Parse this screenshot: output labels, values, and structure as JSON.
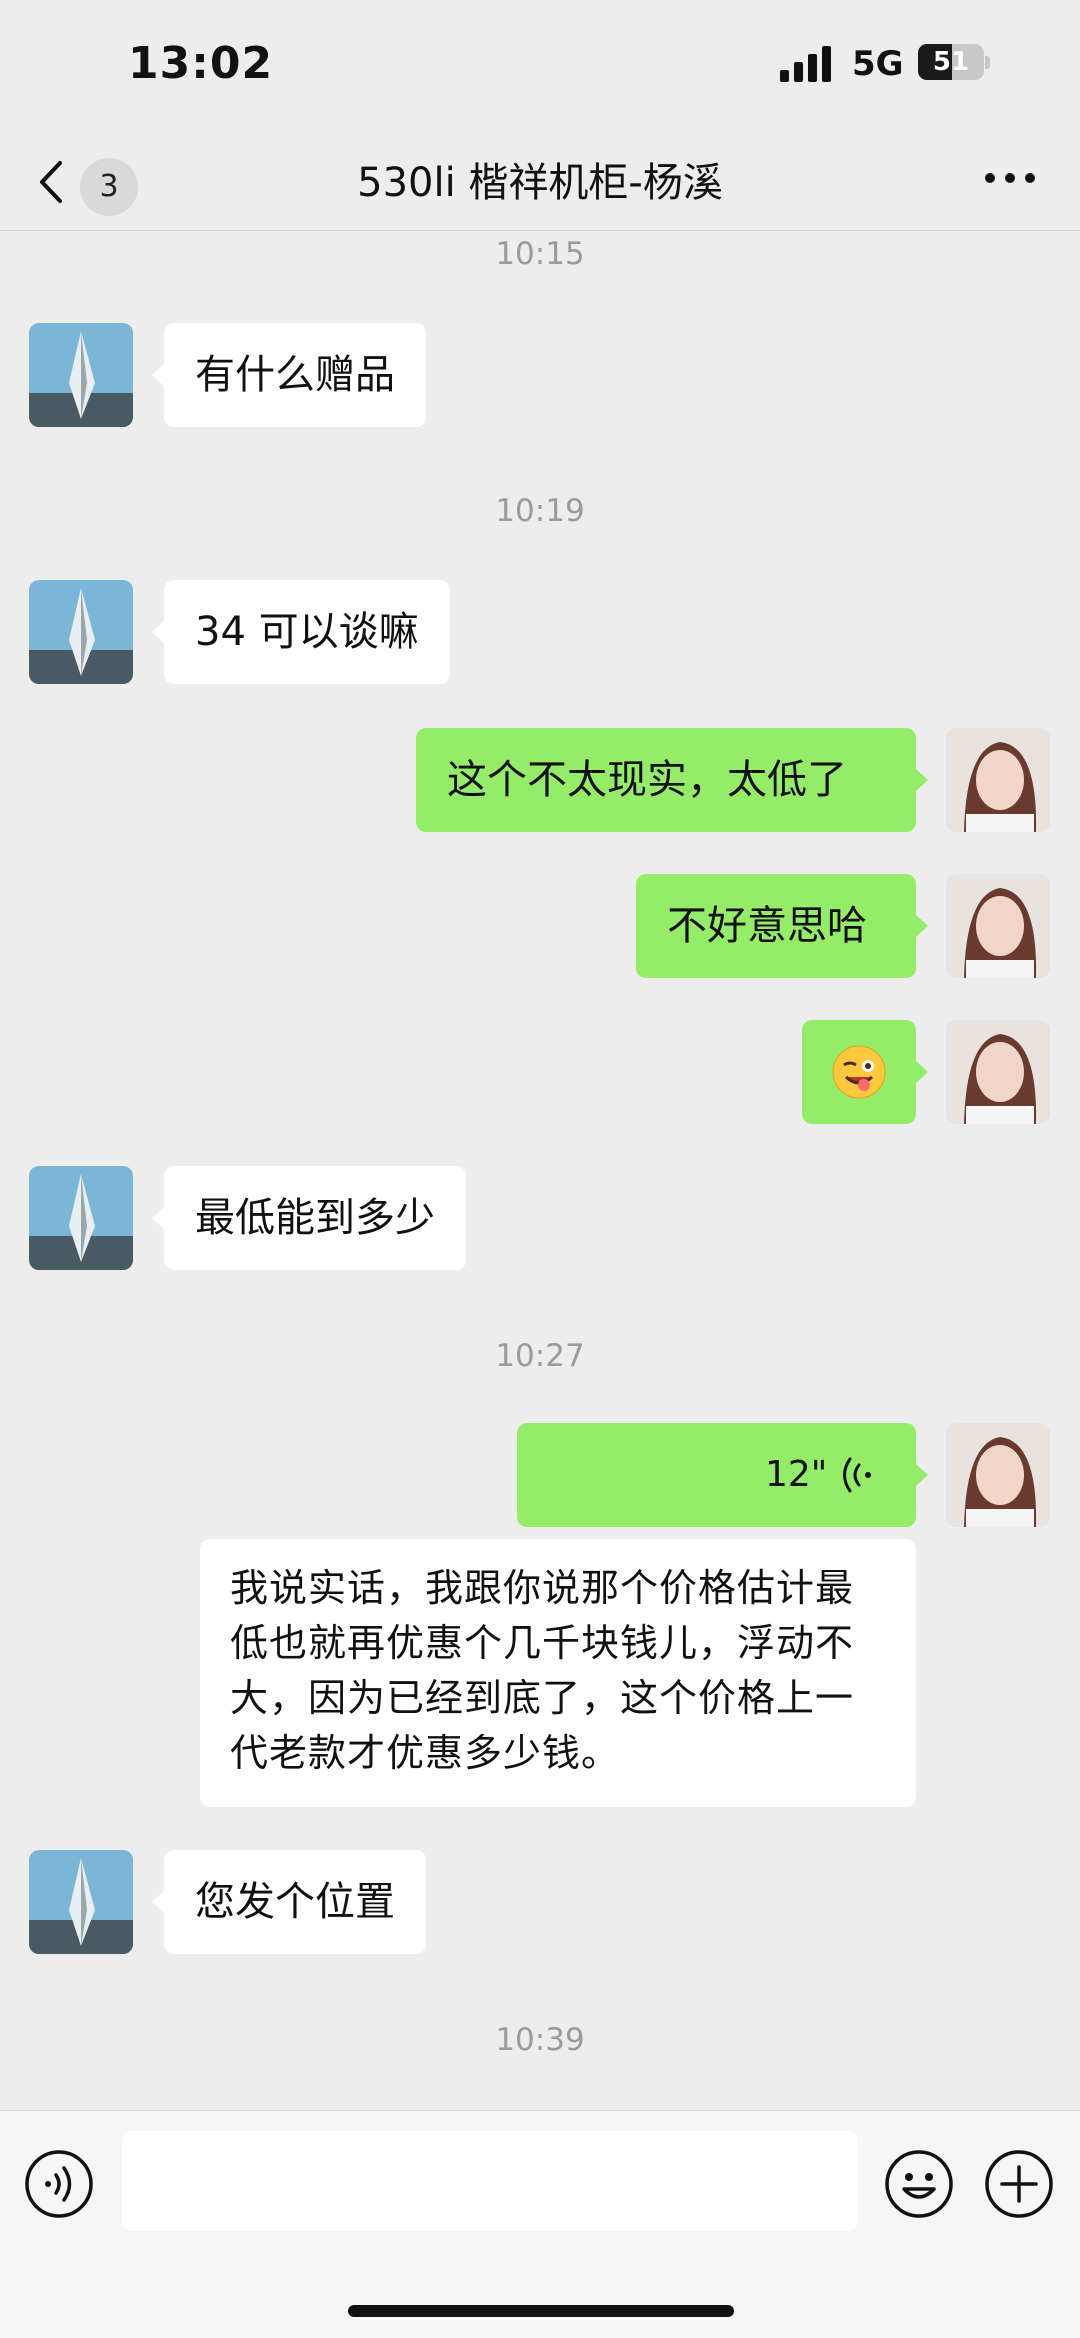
{
  "status_bar": {
    "time": "13:02",
    "network": "5G",
    "battery": "51",
    "battery_level": 0.51
  },
  "nav": {
    "unread_count": "3",
    "title": "530li 楷祥机柜-杨溪"
  },
  "chat": {
    "time_1": "10:15",
    "msg_gift": "有什么赠品",
    "time_2": "10:19",
    "msg_34": "34 可以谈嘛",
    "msg_not_realistic": "这个不太现实，太低了",
    "msg_sorry": "不好意思哈",
    "msg_emoji": "😜",
    "msg_lowest": "最低能到多少",
    "time_3": "10:27",
    "voice_duration": "12\"",
    "transcript": "我说实话，我跟你说那个价格估计最低也就再优惠个几千块钱儿，浮动不大，因为已经到底了，这个价格上一代老款才优惠多少钱。",
    "msg_location": "您发个位置",
    "time_4": "10:39"
  },
  "input": {
    "value": ""
  },
  "colors": {
    "background": "#ededed",
    "outgoing_bubble": "#95ec69",
    "incoming_bubble": "#ffffff",
    "timestamp": "#9b9b9b"
  }
}
